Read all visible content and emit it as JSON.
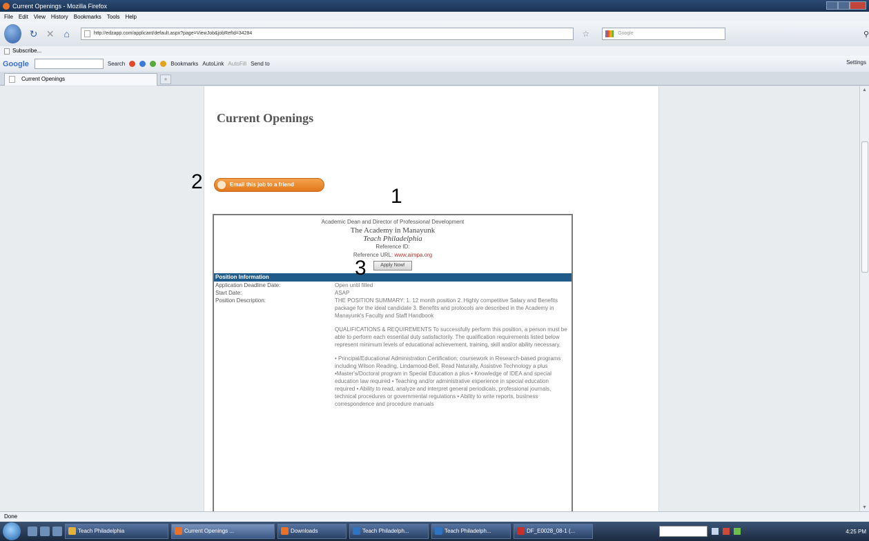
{
  "window": {
    "title": "Current Openings - Mozilla Firefox"
  },
  "menu": [
    "File",
    "Edit",
    "View",
    "History",
    "Bookmarks",
    "Tools",
    "Help"
  ],
  "nav": {
    "url": "http://edzapp.com/applicant/default.aspx?page=ViewJob&jobRefId=34284",
    "search_placeholder": "Google"
  },
  "bookmarks": {
    "item": "Subscribe..."
  },
  "googlebar": {
    "logo": "Google",
    "items": [
      "Search",
      "Bookmarks",
      "AutoLink",
      "AutoFill",
      "Send to"
    ],
    "settings": "Settings"
  },
  "tabs": [
    {
      "label": "Current Openings"
    }
  ],
  "page": {
    "title": "Current Openings",
    "email_button": "Email this job to a friend",
    "annotations": [
      "1",
      "2",
      "3"
    ],
    "job": {
      "position_title": "Academic Dean and Director of Professional Development",
      "school": "The Academy in Manayunk",
      "district": "Teach Philadelphia",
      "reference_id_label": "Reference ID:",
      "reference_url_label": "Reference URL:",
      "reference_url": "www.aimpa.org",
      "apply_button": "Apply Now!",
      "section_header": "Position Information",
      "fields": [
        {
          "label": "Application Deadline Date:",
          "value": "Open until filled"
        },
        {
          "label": "Start Date:",
          "value": "ASAP"
        }
      ],
      "description_label": "Position Description:",
      "description": [
        "THE POSITION SUMMARY: 1. 12 month position 2. Highly competitive Salary and Benefits package for the ideal candidate 3. Benefits and protocols are described in the Academy in Manayunk's Faculty and Staff Handbook",
        "QUALIFICATIONS & REQUIREMENTS To successfully perform this position, a person must be able to perform each essential duty satisfactorily. The qualification requirements listed below represent minimum levels of educational achievement, training, skill and/or ability necessary.",
        "• Principal/Educational Administration Certification; coursework in Research-based programs including Wilson Reading, Lindamood-Bell, Read Naturally, Assistive Technology a plus •Master's/Doctoral program in Special Education a plus • Knowledge of IDEA and special education law required • Teaching and/or administrative experience in special education required • Ability to read, analyze and interpret general periodicals, professional journals, technical procedures or governmental regulations • Ability to write reports, business correspondence and procedure manuals"
      ]
    }
  },
  "status": {
    "text": "Done"
  },
  "taskbar": {
    "tasks": [
      "Teach Philadelphia",
      "Current Openings ...",
      "Downloads",
      "Teach Philadelph...",
      "Teach Philadelph...",
      "DF_E0028_08-1 (..."
    ],
    "clock": "4:25 PM"
  }
}
